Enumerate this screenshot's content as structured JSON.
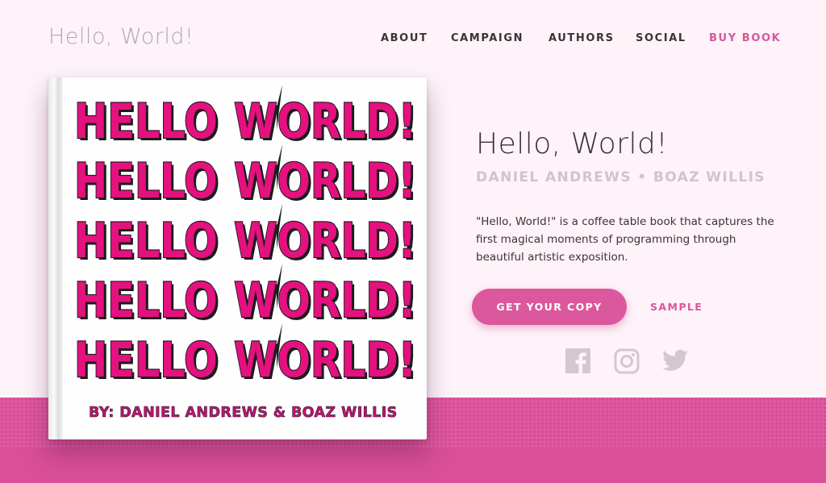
{
  "header": {
    "logo": "Hello, World!",
    "nav": [
      {
        "label": "ABOUT"
      },
      {
        "label": "CAMPAIGN"
      },
      {
        "label": "AUTHORS"
      },
      {
        "label": "SOCIAL"
      },
      {
        "label": "BUY BOOK"
      }
    ]
  },
  "book_cover": {
    "line_left": "HELLO",
    "line_right": "WORLD!",
    "byline": "BY: DANIEL ANDREWS & BOAZ WILLIS"
  },
  "hero": {
    "title": "Hello, World!",
    "authors": "DANIEL ANDREWS • BOAZ WILLIS",
    "description": "\"Hello, World!\" is a coffee table book that captures the first magical moments of programming through beautiful artistic exposition.",
    "cta_label": "GET YOUR COPY",
    "sample_label": "SAMPLE"
  },
  "social": {
    "icons": [
      "facebook-icon",
      "instagram-icon",
      "twitter-icon"
    ]
  },
  "colors": {
    "accent": "#dc589e",
    "background": "#fdf3f9",
    "cover_pink": "#e4117f",
    "text_dark": "#3b3336",
    "muted": "#d1c4cc"
  }
}
